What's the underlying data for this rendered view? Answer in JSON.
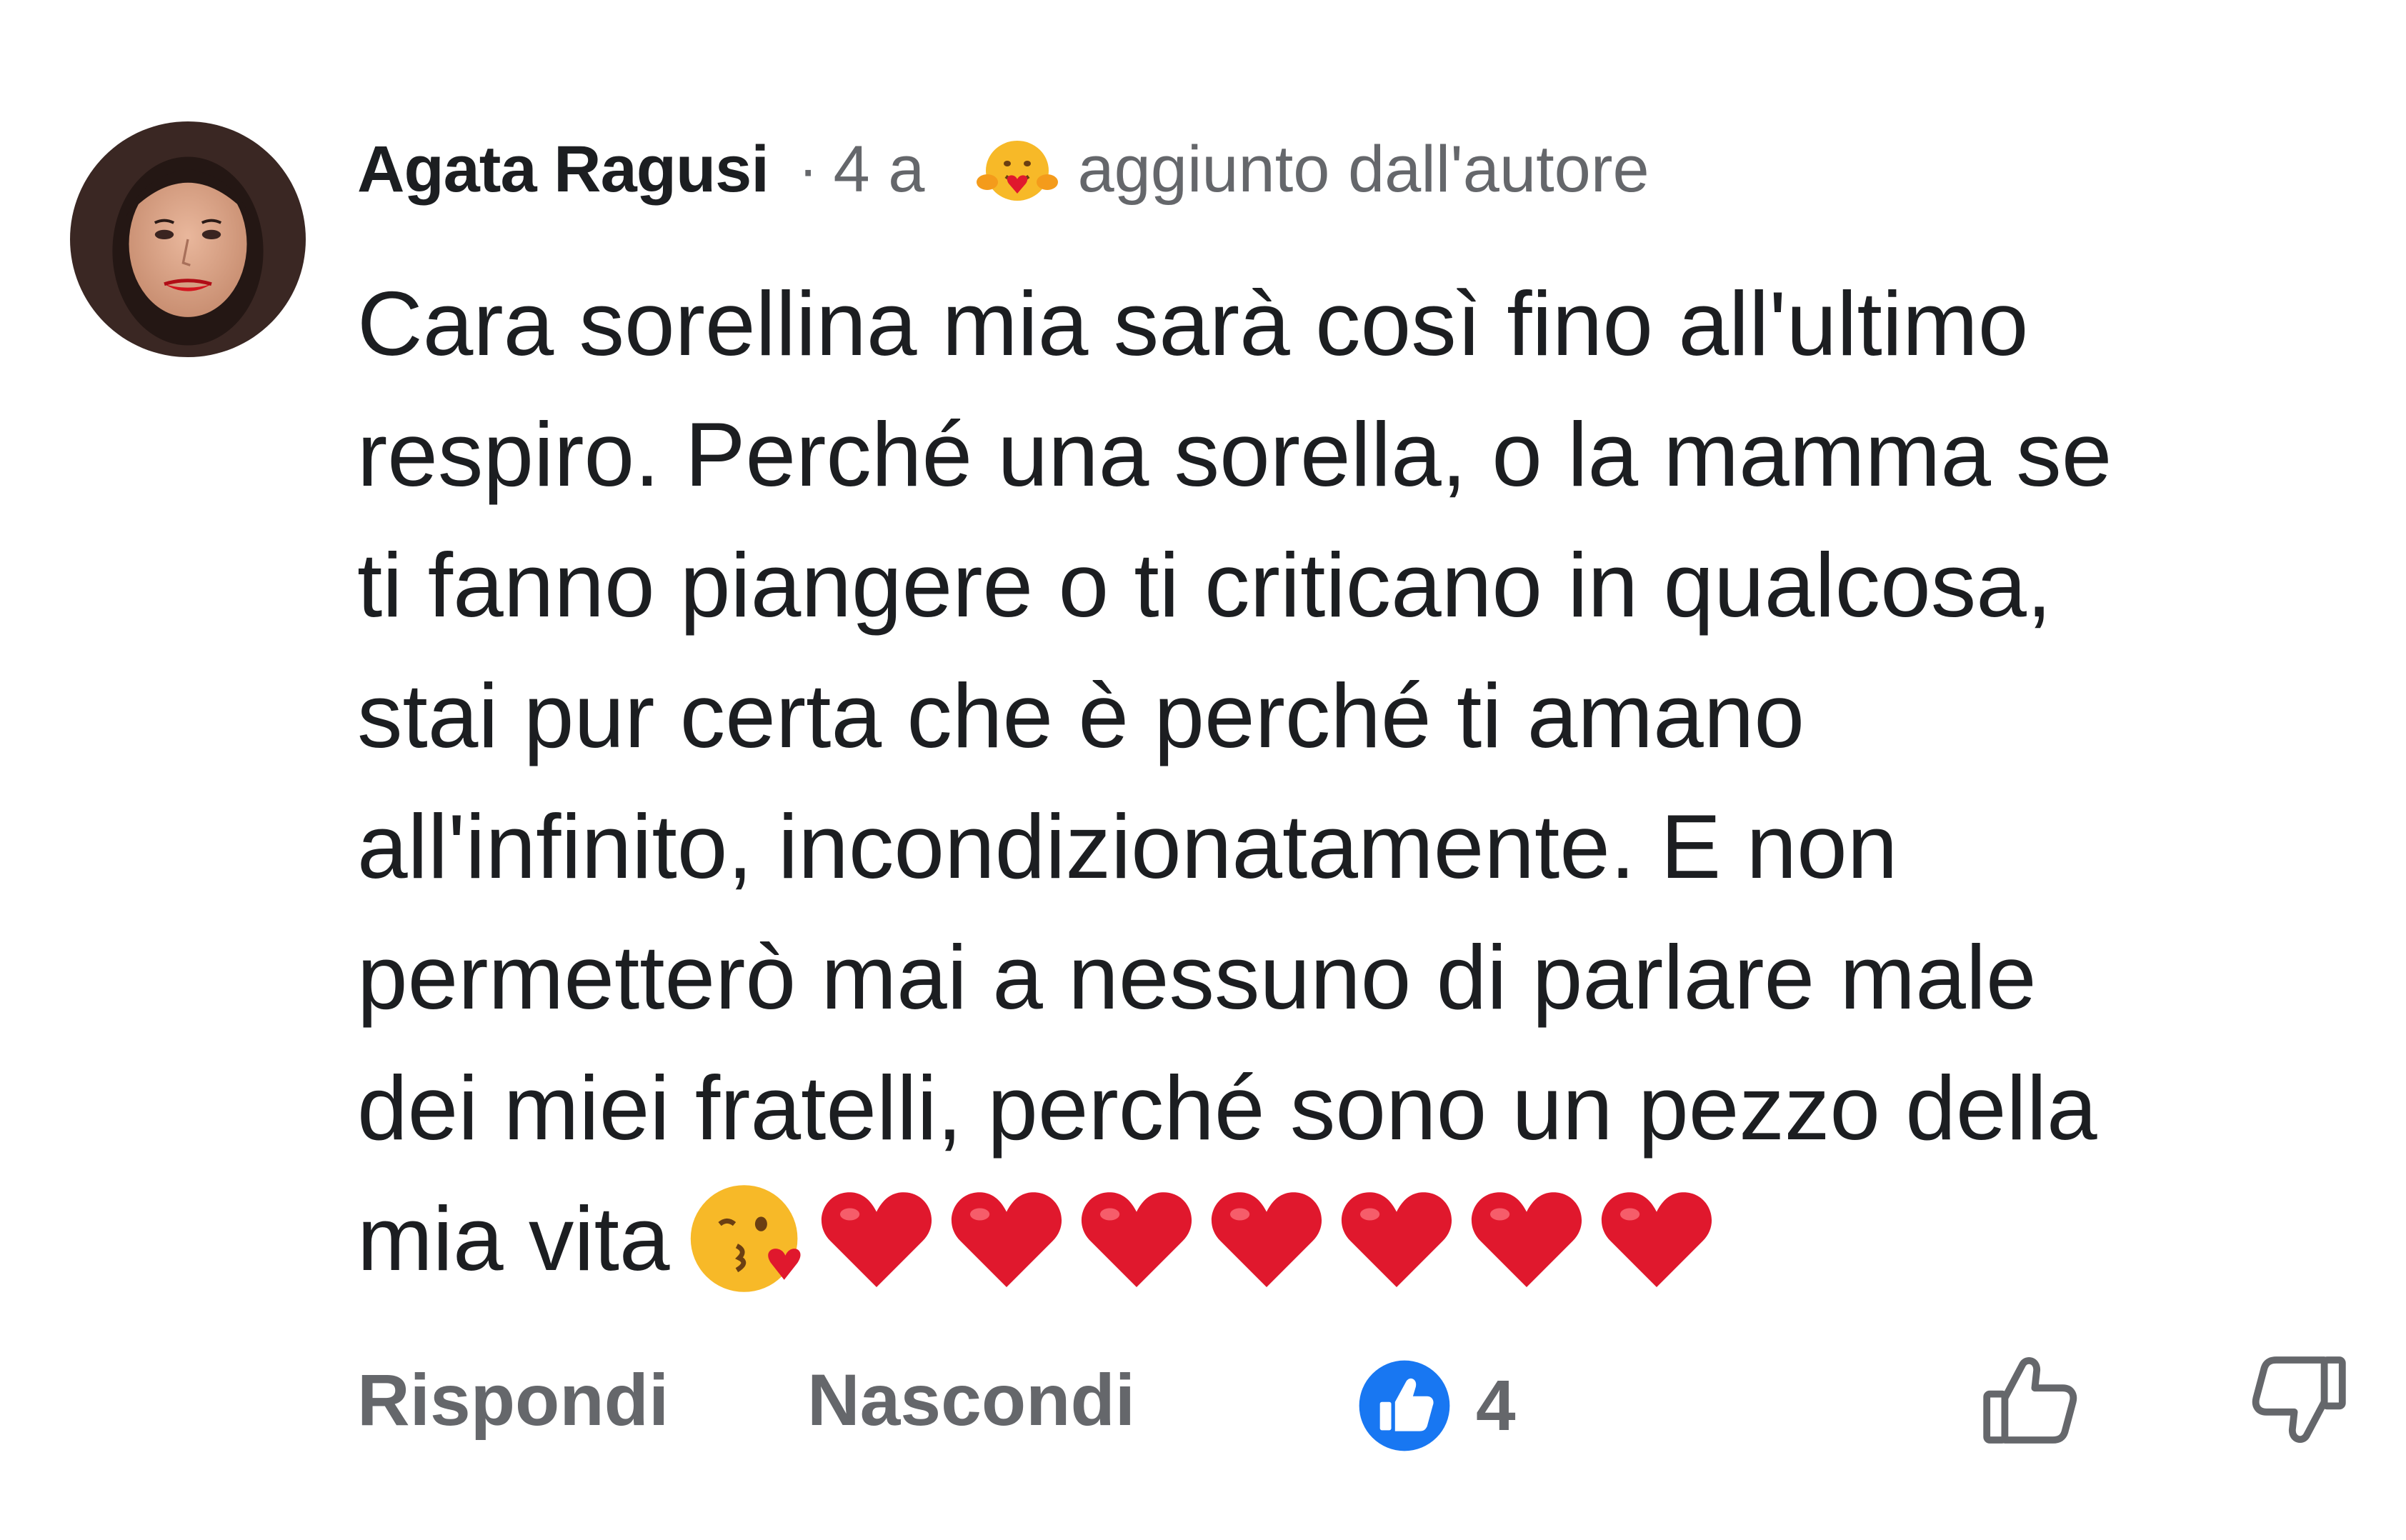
{
  "comment": {
    "author_name": "Agata Ragusi",
    "separator": "·",
    "time_ago": "4 a",
    "author_badge": {
      "icon": "hug-emoji-icon",
      "text": "aggiunto dall'autore"
    },
    "text_lines": [
      "Cara sorellina mia sarà così fino all'ultimo",
      "respiro. Perché una sorella, o la mamma se",
      "ti fanno piangere o ti criticano in qualcosa,",
      "stai pur certa che è perché ti amano",
      "all'infinito, incondizionatamente. E non",
      "permetterò mai a nessuno di parlare male",
      "dei miei fratelli, perché sono un pezzo della",
      "mia vita"
    ],
    "trailing_emojis": [
      "kissing-face-icon",
      "red-heart-icon",
      "red-heart-icon",
      "red-heart-icon",
      "red-heart-icon",
      "red-heart-icon",
      "red-heart-icon",
      "red-heart-icon"
    ]
  },
  "actions": {
    "reply_label": "Rispondi",
    "hide_label": "Nascondi",
    "reaction_icon": "like-badge-icon",
    "reaction_count": "4",
    "upvote_icon": "thumbs-up-icon",
    "downvote_icon": "thumbs-down-icon"
  },
  "colors": {
    "text_primary": "#1c1e21",
    "text_secondary": "#65676b",
    "like_blue": "#1877f2",
    "heart_red": "#e0182d"
  }
}
